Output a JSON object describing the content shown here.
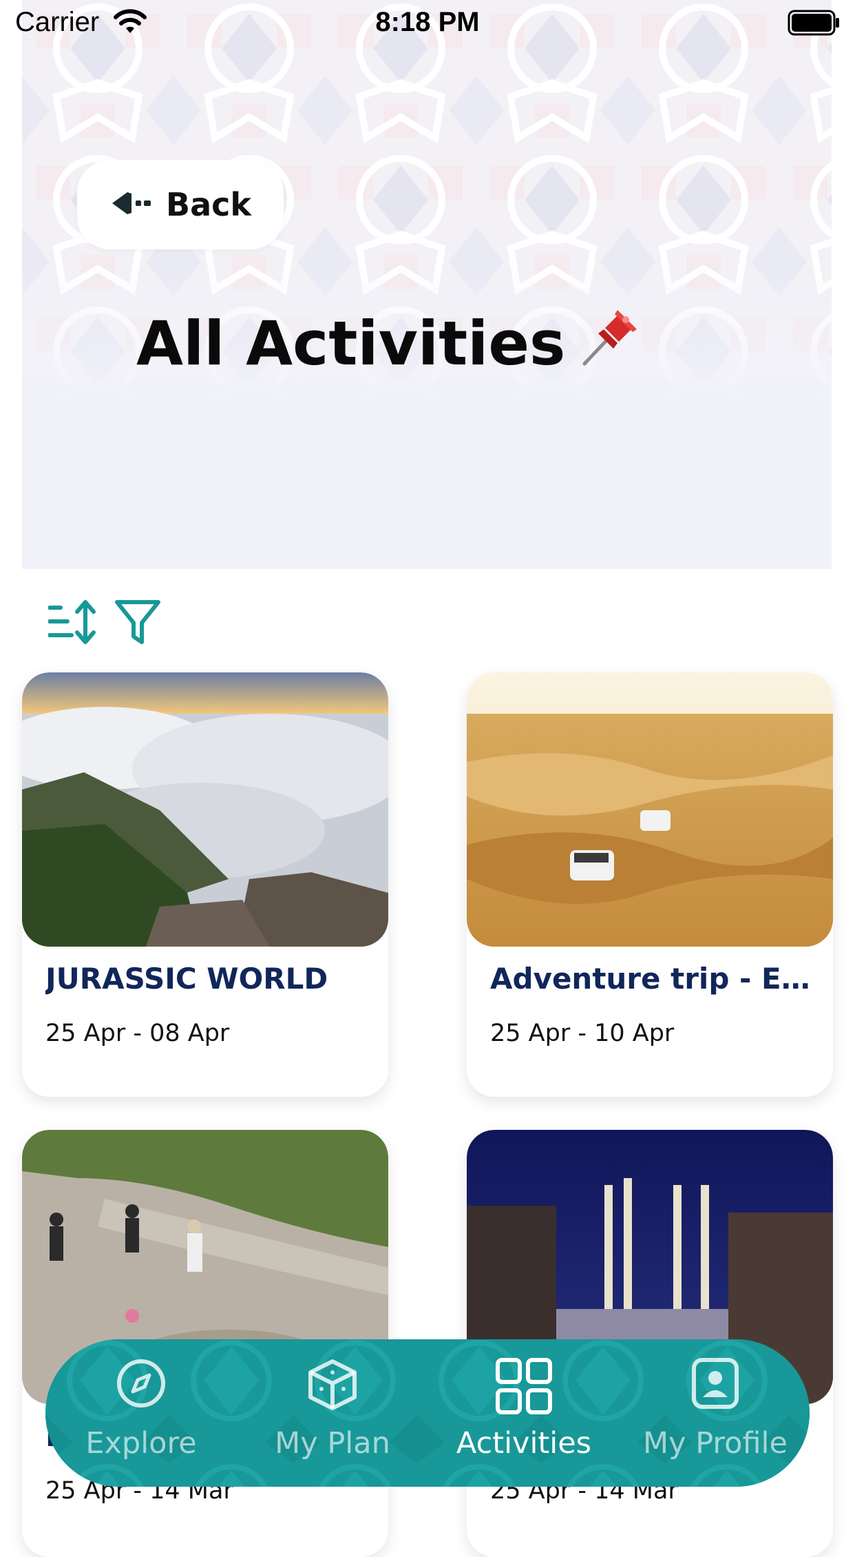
{
  "status_bar": {
    "carrier": "Carrier",
    "time": "8:18 PM"
  },
  "header": {
    "back_label": "Back",
    "title": "All Activities",
    "title_emoji": "📌"
  },
  "toolbar": {
    "sort_icon": "sort-icon",
    "filter_icon": "filter-icon"
  },
  "activities": [
    {
      "title": "JURASSIC WORLD",
      "dates": "25 Apr - 08 Apr"
    },
    {
      "title": "Adventure trip - E…",
      "dates": "25 Apr - 10 Apr"
    },
    {
      "title": "H",
      "dates": "25 Apr - 14 Mar"
    },
    {
      "title": "",
      "dates": "25 Apr - 14 Mar"
    }
  ],
  "nav": [
    {
      "label": "Explore",
      "icon": "compass-icon",
      "active": false
    },
    {
      "label": "My Plan",
      "icon": "cube-icon",
      "active": false
    },
    {
      "label": "Activities",
      "icon": "grid-icon",
      "active": true
    },
    {
      "label": "My Profile",
      "icon": "profile-icon",
      "active": false
    }
  ],
  "colors": {
    "accent": "#189898",
    "title_navy": "#11265a",
    "header_bg": "#f1f2f9"
  }
}
